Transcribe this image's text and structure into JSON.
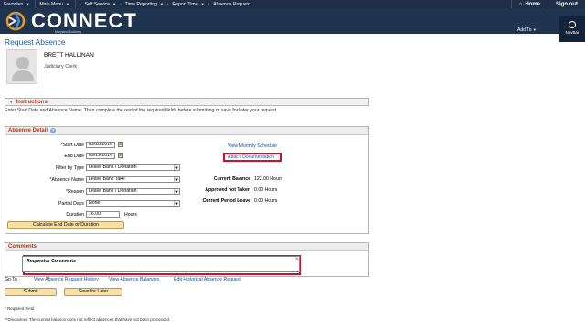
{
  "menubar": {
    "favorites": "Favorites",
    "main_menu": "Main Menu",
    "breadcrumbs": [
      "Self Service",
      "Time Reporting",
      "Report Time",
      "Absence Request"
    ],
    "home": "Home",
    "sign_out": "Sign out"
  },
  "banner": {
    "brand": "CONNECT",
    "sub": "Maryland Judiciary",
    "add_to": "Add To",
    "navbar": "NavBar"
  },
  "page": {
    "title": "Request Absence"
  },
  "employee": {
    "name": "BRETT HALLINAN",
    "job_title": "Judiciary Clerk"
  },
  "instructions": {
    "header": "Instructions",
    "text": "Enter Start Date and Absence Name. Then complete the rest of the required fields before submitting or save for later your request."
  },
  "absence_detail": {
    "header": "Absence Detail",
    "start_date_label": "*Start Date",
    "start_date": "09/28/2016",
    "end_date_label": "End Date",
    "end_date": "09/29/2016",
    "filter_label": "Filter by Type",
    "filter_value": "Leave Bank / Donation",
    "absence_name_label": "*Absence Name",
    "absence_name_value": "Leave Bank Take",
    "reason_label": "*Reason",
    "reason_value": "Leave Bank / Donation",
    "partial_days_label": "Partial Days",
    "partial_days_value": "None",
    "duration_label": "Duration",
    "duration_value": "16.00",
    "duration_unit": "Hours",
    "calc_button": "Calculate End Date or Duration",
    "view_schedule": "View Monthly Schedule",
    "attach_docs": "Attach Documentation",
    "current_balance_label": "Current Balance",
    "current_balance_value": "122.00 Hours",
    "approved_label": "Approved not Taken",
    "approved_value": "0.00 Hours",
    "current_period_label": "Current Period Leave",
    "current_period_value": "0.00 Hours"
  },
  "comments": {
    "header": "Comments",
    "field_label": "Requestor Comments"
  },
  "goto": {
    "label": "Go To",
    "links": [
      "View Absence Request History",
      "View Absence Balances",
      "Edit Historical Absence Request"
    ]
  },
  "buttons": {
    "submit": "Submit",
    "save_later": "Save for Later"
  },
  "footer": {
    "required": "* Required Field",
    "disclaimer": "**Disclaimer: The current balance does not reflect absences that have not been processed."
  },
  "colors": {
    "header_navy": "#20334f",
    "section_orange": "#b53a12",
    "link_blue": "#1a4fa0",
    "highlight_red": "#d0102a",
    "button_gold": "#f6e0a6"
  }
}
